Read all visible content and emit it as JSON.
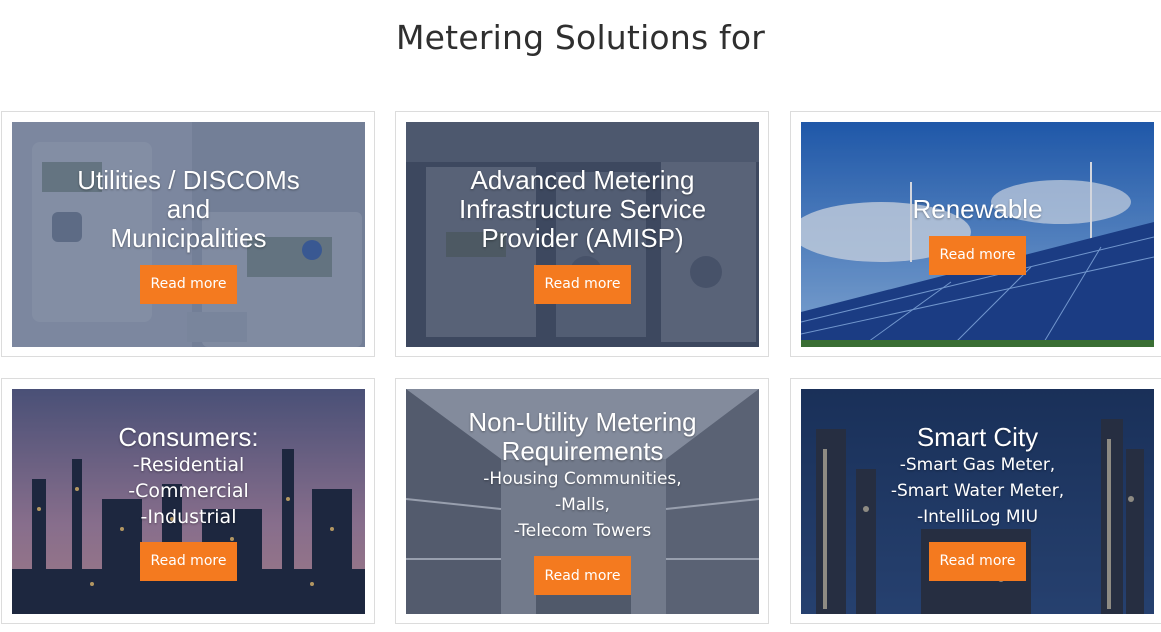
{
  "section": {
    "title": "Metering Solutions for"
  },
  "cards": [
    {
      "title_lines": [
        "Utilities / DISCOMs",
        "and",
        "Municipalities"
      ],
      "sub_lines": [],
      "button_label": "Read more",
      "image": "electricity-meter-photo"
    },
    {
      "title_lines": [
        "Advanced Metering",
        "Infrastructure Service",
        "Provider (AMISP)"
      ],
      "sub_lines": [],
      "button_label": "Read more",
      "image": "meter-panel-photo"
    },
    {
      "title_lines": [
        "Renewable"
      ],
      "sub_lines": [],
      "button_label": "Read more",
      "image": "solar-wind-photo"
    },
    {
      "title_lines": [
        "Consumers:"
      ],
      "sub_lines": [
        "-Residential",
        "-Commercial",
        "-Industrial"
      ],
      "button_label": "Read more",
      "image": "refinery-dusk-photo"
    },
    {
      "title_lines": [
        "Non-Utility Metering",
        "Requirements"
      ],
      "sub_lines": [
        "-Housing Communities,",
        "-Malls,",
        "-Telecom Towers"
      ],
      "button_label": "Read more",
      "image": "shopping-mall-photo"
    },
    {
      "title_lines": [
        "Smart City"
      ],
      "sub_lines": [
        "-Smart Gas Meter,",
        "-Smart Water Meter,",
        "-IntelliLog MIU"
      ],
      "button_label": "Read more",
      "image": "industrial-night-photo"
    }
  ],
  "colors": {
    "accent": "#f47a1f",
    "overlay": "#1f2f4f"
  }
}
